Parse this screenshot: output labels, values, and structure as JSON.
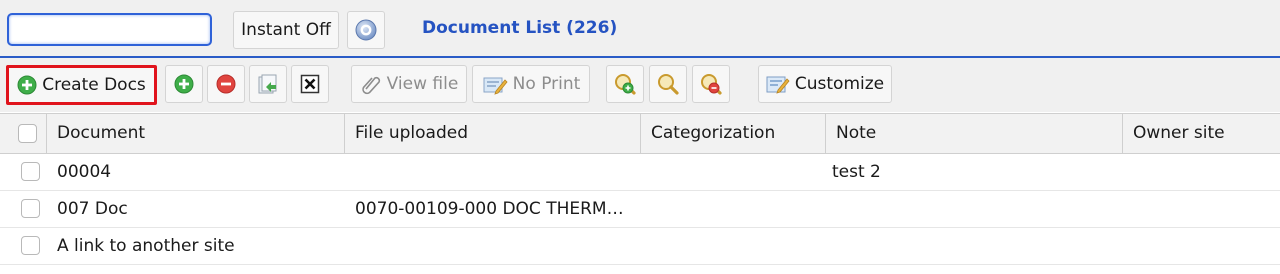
{
  "header": {
    "search": {
      "value": "",
      "placeholder": ""
    },
    "instant_label": "Instant Off",
    "help_icon": "help-icon",
    "title": "Document List (226)"
  },
  "toolbar": {
    "create_label": "Create Docs",
    "view_file_label": "View file",
    "no_print_label": "No Print",
    "customize_label": "Customize",
    "icons": [
      "add-icon",
      "add-icon",
      "remove-icon",
      "refresh-icon",
      "close-box-icon",
      "paperclip-icon",
      "print-edit-icon",
      "zoom-in-icon",
      "zoom-icon",
      "zoom-out-icon",
      "customize-icon"
    ],
    "colors": {
      "add": "#3fae49",
      "remove": "#e0443f",
      "highlight": "#e0131c"
    }
  },
  "table": {
    "columns": [
      "Document",
      "File uploaded",
      "Categorization",
      "Note",
      "Owner site"
    ],
    "rows": [
      {
        "document": "00004",
        "file_uploaded": "",
        "categorization": "",
        "note": "test 2",
        "owner_site": ""
      },
      {
        "document": "007 Doc",
        "file_uploaded": "0070-00109-000 DOC THERMO…",
        "categorization": "",
        "note": "",
        "owner_site": ""
      },
      {
        "document": "A link to another site",
        "file_uploaded": "",
        "categorization": "",
        "note": "",
        "owner_site": ""
      }
    ]
  },
  "colors": {
    "accent": "#2553c2",
    "toolbar_bg": "#f0f0f0"
  }
}
